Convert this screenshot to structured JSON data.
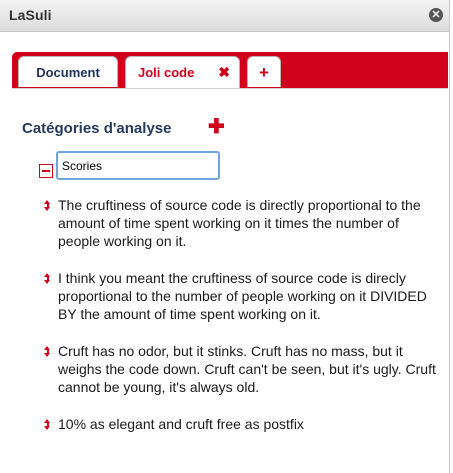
{
  "window": {
    "title": "LaSuli",
    "close_icon": "close-icon"
  },
  "tabs": [
    {
      "label": "Document",
      "active": false
    },
    {
      "label": "Joli code",
      "active": true,
      "close_icon": "✖"
    },
    {
      "label": "+"
    }
  ],
  "section": {
    "title": "Catégories d'analyse",
    "add_icon": "✚"
  },
  "category": {
    "value": "Scories"
  },
  "items": [
    {
      "text": "The cruftiness of source code is directly proportional to the amount of time spent working on it times the number of people working on it."
    },
    {
      "text": "I think you meant the cruftiness of source code is direcly proportional to the number of people working on it DIVIDED BY the amount of time spent working on it."
    },
    {
      "text": "Cruft has no odor, but it stinks. Cruft has no mass, but it weighs the code down. Cruft can't be seen, but it's ugly. Cruft cannot be young, it's always old."
    },
    {
      "text": "10% as elegant and cruft free as postfix"
    }
  ],
  "colors": {
    "accent": "#d1001b",
    "title_text": "#263a5e",
    "input_border": "#6ea5e0"
  }
}
